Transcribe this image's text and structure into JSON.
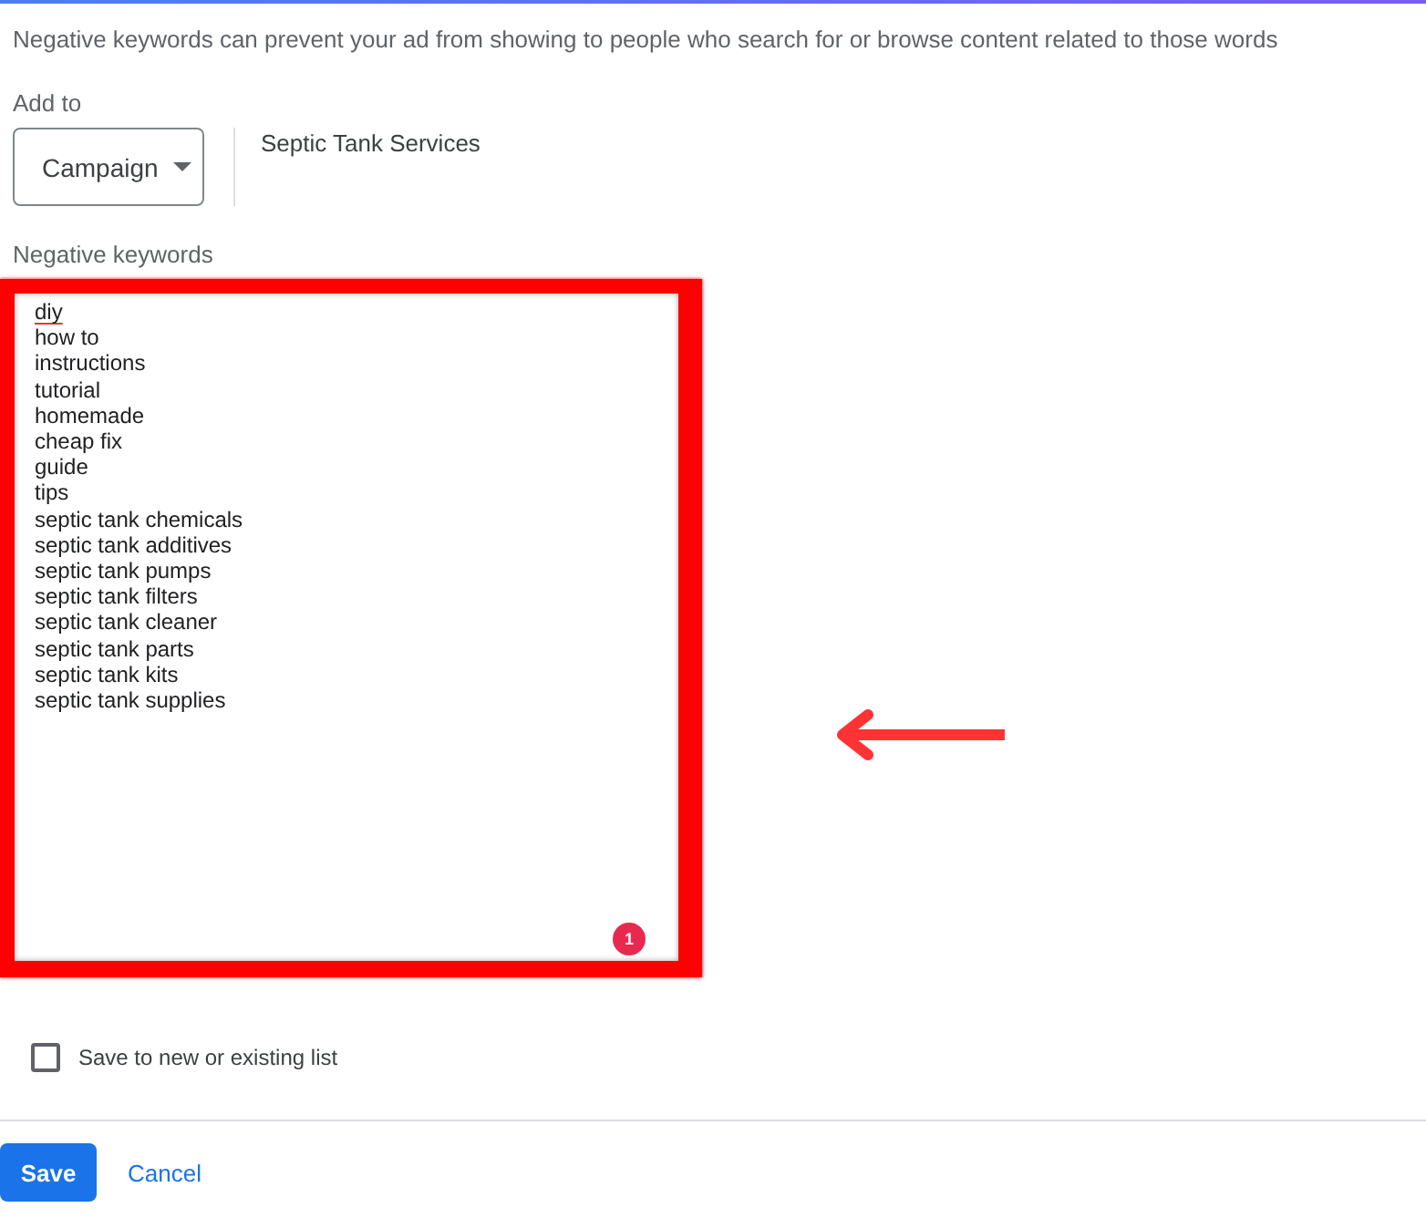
{
  "description": "Negative keywords can prevent your ad from showing to people who search for or browse content related to those words",
  "add_to": {
    "label": "Add to",
    "dropdown": {
      "value": "Campaign"
    },
    "campaign_name": "Septic Tank Services"
  },
  "negative_keywords": {
    "label": "Negative keywords",
    "highlighted": true,
    "badge": "1",
    "keywords": [
      {
        "text": "diy",
        "misspelled": true
      },
      {
        "text": "how to",
        "misspelled": false
      },
      {
        "text": "instructions",
        "misspelled": false
      },
      {
        "text": "tutorial",
        "misspelled": false
      },
      {
        "text": "homemade",
        "misspelled": false
      },
      {
        "text": "cheap fix",
        "misspelled": false
      },
      {
        "text": "guide",
        "misspelled": false
      },
      {
        "text": "tips",
        "misspelled": false
      },
      {
        "text": "septic tank chemicals",
        "misspelled": false
      },
      {
        "text": "septic tank additives",
        "misspelled": false
      },
      {
        "text": "septic tank pumps",
        "misspelled": false
      },
      {
        "text": "septic tank filters",
        "misspelled": false
      },
      {
        "text": "septic tank cleaner",
        "misspelled": false
      },
      {
        "text": "septic tank parts",
        "misspelled": false
      },
      {
        "text": "septic tank kits",
        "misspelled": false
      },
      {
        "text": "septic tank supplies",
        "misspelled": false
      }
    ]
  },
  "save_to_list": {
    "label": "Save to new or existing list",
    "checked": false
  },
  "buttons": [
    {
      "label": "Save",
      "kind": "primary"
    },
    {
      "label": "Cancel",
      "kind": "text"
    }
  ]
}
